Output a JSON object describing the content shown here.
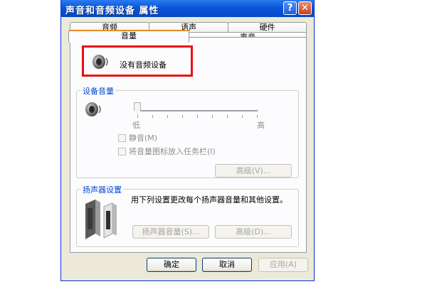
{
  "window": {
    "title": "声音和音频设备 属性",
    "help_label": "?",
    "close_label": "✕"
  },
  "tabs": {
    "back_row": [
      "音频",
      "语声",
      "硬件"
    ],
    "front_row": [
      {
        "label": "音量",
        "active": true
      },
      {
        "label": "声音",
        "active": false
      }
    ]
  },
  "status": {
    "icon": "speaker-icon",
    "text": "没有音频设备"
  },
  "device_volume": {
    "legend": "设备音量",
    "icon": "speaker-icon",
    "slider": {
      "min_label": "低",
      "max_label": "高",
      "value": 0
    },
    "mute": {
      "label": "静音(M)",
      "checked": false,
      "enabled": false
    },
    "tray_icon": {
      "label": "将音量图标放入任务栏(I)",
      "checked": false,
      "enabled": false
    },
    "advanced_button": "高级(V)..."
  },
  "speaker_settings": {
    "legend": "扬声器设置",
    "icon": "speakers-icon",
    "description": "用下列设置更改每个扬声器音量和其他设置。",
    "volume_button": "扬声器音量(S)...",
    "advanced_button": "高级(D)..."
  },
  "footer": {
    "ok": "确定",
    "cancel": "取消",
    "apply": "应用(A)"
  },
  "colors": {
    "titlebar": "#0a56d8",
    "dialog_bg": "#ece9d8",
    "panel_bg": "#fcfcfe",
    "highlight_box": "#e81010",
    "group_label": "#0046d5"
  }
}
